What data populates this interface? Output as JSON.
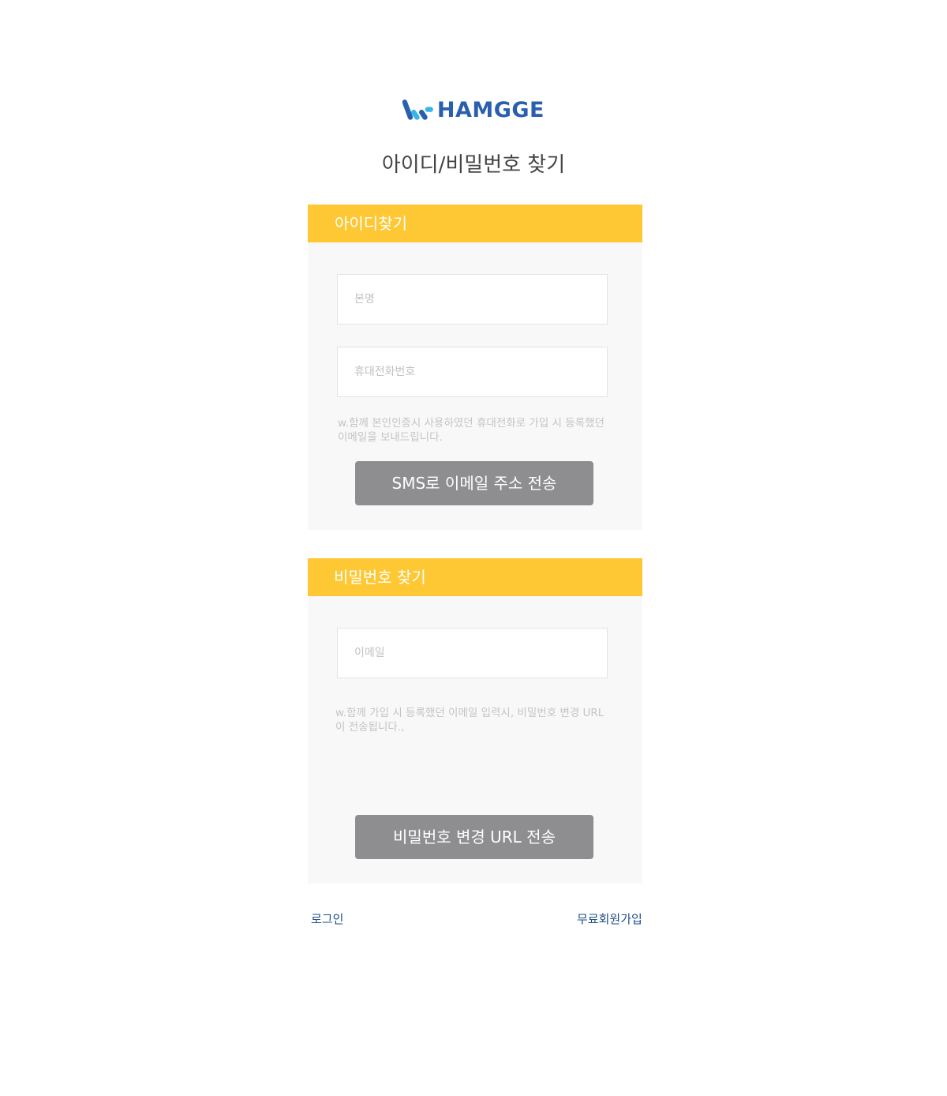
{
  "brand": {
    "logo_text": "HAMGGE",
    "logo_color": "#2a5fae"
  },
  "page_title": "아이디/비밀번호 찾기",
  "find_id": {
    "header": "아이디찾기",
    "name_placeholder": "본명",
    "phone_placeholder": "휴대전화번호",
    "help_text": "w.함께 본인인증시 사용하였던 휴대전화로 가입 시 등록했던 이메일을 보내드립니다.",
    "submit_label": "SMS로 이메일 주소 전송"
  },
  "find_password": {
    "header": "비밀번호 찾기",
    "email_placeholder": "이메일",
    "help_text": "w.함께 가입 시 등록했던 이메일 입력시, 비밀번호 변경 URL이 전송됩니다.,",
    "submit_label": "비밀번호 변경 URL 전송"
  },
  "footer": {
    "login_label": "로그인",
    "signup_label": "무료회원가입"
  },
  "colors": {
    "accent": "#fdc834",
    "panel_bg": "#f8f8f8",
    "button_bg": "#8e8e90",
    "link": "#1e4e8c"
  }
}
